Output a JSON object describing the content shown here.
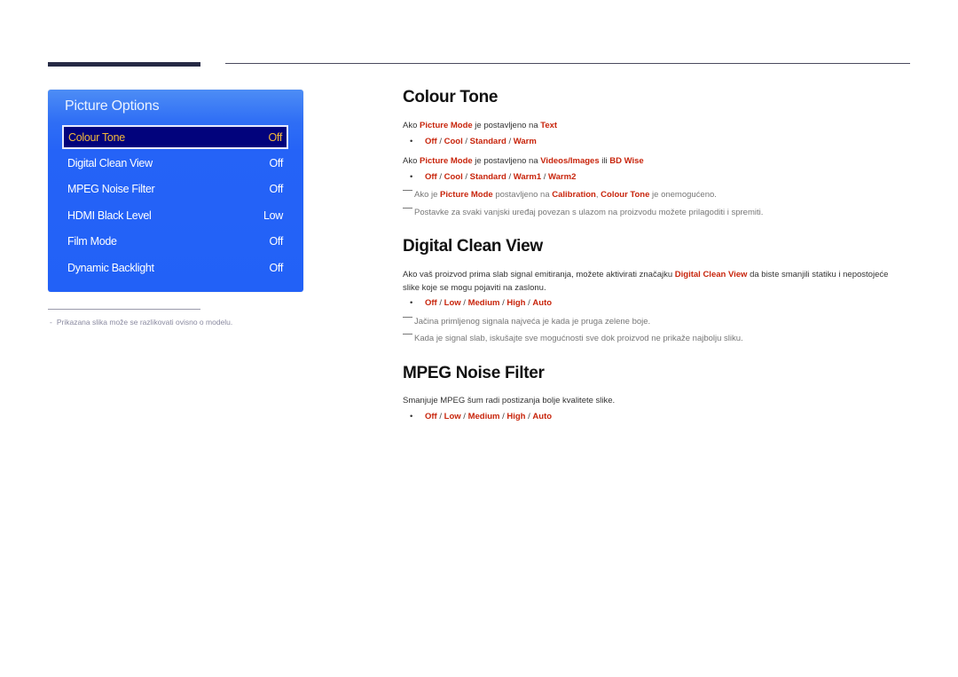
{
  "osd": {
    "title": "Picture Options",
    "items": [
      {
        "label": "Colour Tone",
        "value": "Off",
        "selected": true
      },
      {
        "label": "Digital Clean View",
        "value": "Off"
      },
      {
        "label": "MPEG Noise Filter",
        "value": "Off"
      },
      {
        "label": "HDMI Black Level",
        "value": "Low"
      },
      {
        "label": "Film Mode",
        "value": "Off"
      },
      {
        "label": "Dynamic Backlight",
        "value": "Off"
      }
    ],
    "colors": {
      "panel": "#2261f7",
      "selected_bg": "#02037c",
      "selected_text": "#f3b83a"
    }
  },
  "footnote": {
    "dash": "-",
    "text": "Prikazana slika može se razlikovati ovisno o modelu."
  },
  "accent_color": "#c8250c",
  "sections": {
    "colour_tone": {
      "title": "Colour Tone",
      "line1": {
        "pre": "Ako ",
        "k1": "Picture Mode",
        "mid": " je postavljeno na ",
        "k2": "Text"
      },
      "options1": [
        "Off",
        "Cool",
        "Standard",
        "Warm"
      ],
      "line2": {
        "pre": "Ako ",
        "k1": "Picture Mode",
        "mid": " je postavljeno na ",
        "k2": "Videos/Images",
        "mid2": " ili ",
        "k3": "BD Wise"
      },
      "options2": [
        "Off",
        "Cool",
        "Standard",
        "Warm1",
        "Warm2"
      ],
      "note1": {
        "pre": "Ako je ",
        "k1": "Picture Mode",
        "mid": " postavljeno na ",
        "k2": "Calibration",
        "mid2": ", ",
        "k3": "Colour Tone",
        "post": " je onemogućeno."
      },
      "note2": "Postavke za svaki vanjski uređaj povezan s ulazom na proizvodu možete prilagoditi i spremiti."
    },
    "digital_clean_view": {
      "title": "Digital Clean View",
      "desc": {
        "pre": "Ako vaš proizvod prima slab signal emitiranja, možete aktivirati značajku ",
        "k1": "Digital Clean View",
        "post": " da biste smanjili statiku i nepostojeće slike koje se mogu pojaviti na zaslonu."
      },
      "options": [
        "Off",
        "Low",
        "Medium",
        "High",
        "Auto"
      ],
      "note1": "Jačina primljenog signala najveća je kada je pruga zelene boje.",
      "note2": "Kada je signal slab, iskušajte sve mogućnosti sve dok proizvod ne prikaže najbolju sliku."
    },
    "mpeg_noise_filter": {
      "title": "MPEG Noise Filter",
      "desc": "Smanjuje MPEG šum radi postizanja bolje kvalitete slike.",
      "options": [
        "Off",
        "Low",
        "Medium",
        "High",
        "Auto"
      ]
    }
  }
}
